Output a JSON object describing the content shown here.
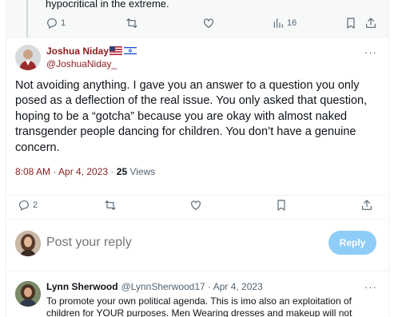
{
  "previous_tweet": {
    "text": "hypocritical in the extreme.",
    "reply_count": "1",
    "retweet_count": "",
    "like_count": "",
    "views": "16"
  },
  "main_tweet": {
    "author_name": "Joshua Niday",
    "flags": [
      "US flag",
      "Israel flag"
    ],
    "handle": "@JoshuaNiday_",
    "text": "Not avoiding anything. I gave you an answer to a question you only posed as a deflection of the real issue. You only asked that question, hoping to be a “gotcha” because you are okay with almost naked transgender people dancing for children. You don’t have a genuine concern.",
    "time": "8:08 AM · Apr 4, 2023",
    "separator": "·",
    "views_count": "25",
    "views_label": "Views",
    "reply_count": "2"
  },
  "composer": {
    "placeholder": "Post your reply",
    "button_label": "Reply"
  },
  "next_reply": {
    "author_name": "Lynn Sherwood",
    "handle_and_date": "@LynnSherwood17 · Apr 4, 2023",
    "text": "To promote your own political agenda. This is imo also an exploitation of children for YOUR purposes.  Men Wearing dresses and makeup will not"
  },
  "more_label": "···",
  "icons": [
    "reply-icon",
    "retweet-icon",
    "like-icon",
    "views-icon",
    "bookmark-icon",
    "share-icon",
    "more-icon"
  ],
  "colors": {
    "accent": "#1d9bf0",
    "reply_button_disabled": "#8ecdf8",
    "name_color": "#8a1d1d",
    "muted": "#536471"
  }
}
